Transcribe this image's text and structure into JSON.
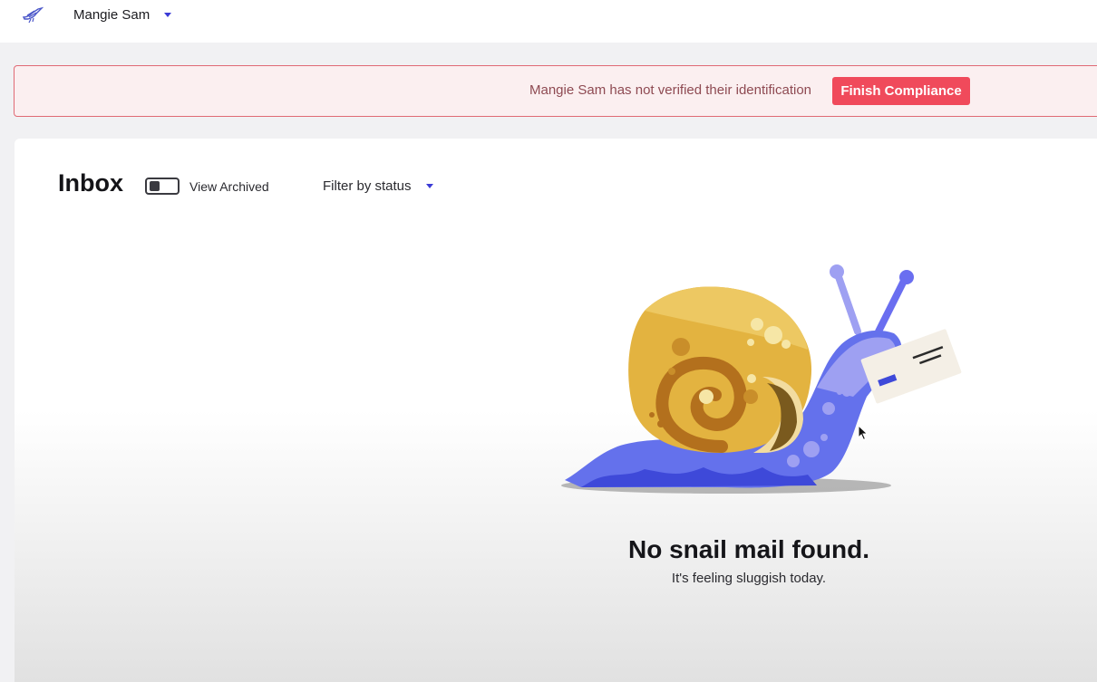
{
  "header": {
    "account_name": "Mangie Sam"
  },
  "alert": {
    "message": "Mangie Sam has not verified their identification",
    "button_label": "Finish Compliance"
  },
  "inbox": {
    "title": "Inbox",
    "view_archived_label": "View Archived",
    "view_archived_on": false,
    "filter_label": "Filter by status"
  },
  "empty_state": {
    "title": "No snail mail found.",
    "subtitle": "It's feeling sluggish today."
  },
  "icons": {
    "logo": "bird-logo-icon",
    "account_caret": "chevron-down-icon",
    "filter_caret": "chevron-down-icon",
    "illustration": "snail-with-envelope-illustration"
  },
  "colors": {
    "accent": "#3b3bd6",
    "alert_bg": "#fbeff0",
    "alert_border": "#e06a75",
    "alert_button": "#f04a5b"
  }
}
